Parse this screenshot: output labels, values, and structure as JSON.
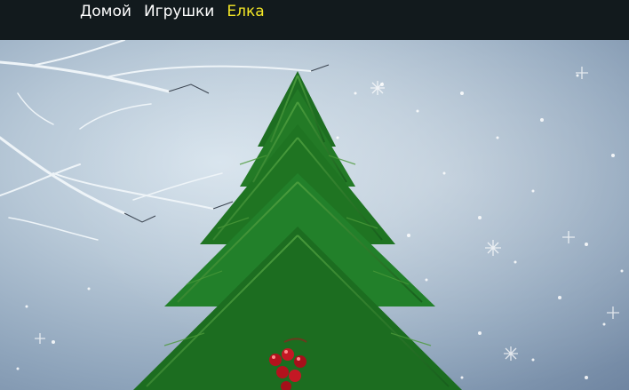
{
  "nav": {
    "items": [
      {
        "label": "Домой",
        "active": false
      },
      {
        "label": "Игрушки",
        "active": false
      },
      {
        "label": "Елка",
        "active": true
      }
    ],
    "active_color": "#f4e726",
    "text_color": "#ffffff",
    "background": "#121a1d"
  },
  "scene": {
    "subject": "christmas-tree",
    "sky_colors": [
      "#d5e2ec",
      "#8ea4bb",
      "#6f85a1"
    ],
    "tree_color": "#1f7a24",
    "ornament_color": "#b3121d"
  }
}
